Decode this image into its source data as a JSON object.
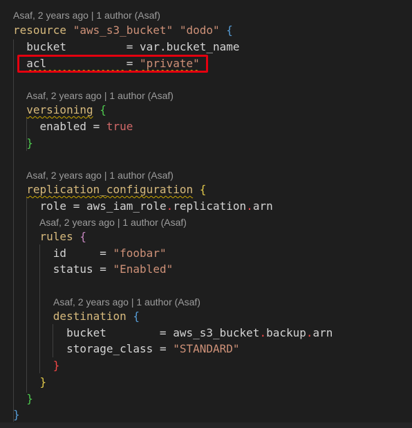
{
  "lens": {
    "resource": "Asaf, 2 years ago | 1 author (Asaf)",
    "versioning": "Asaf, 2 years ago | 1 author (Asaf)",
    "replication": "Asaf, 2 years ago | 1 author (Asaf)",
    "rules": "Asaf, 2 years ago | 1 author (Asaf)",
    "destination": "Asaf, 2 years ago | 1 author (Asaf)"
  },
  "code": {
    "resource_kw": "resource",
    "resource_type": "\"aws_s3_bucket\"",
    "resource_name": "\"dodo\"",
    "open_brace": "{",
    "close_brace": "}",
    "bucket_key": "bucket",
    "bucket_val": "var.bucket_name",
    "acl_key": "acl",
    "acl_val": "\"private\"",
    "versioning_kw": "versioning",
    "enabled_key": "enabled",
    "enabled_val": "true",
    "replication_kw": "replication_configuration",
    "role_key": "role",
    "role_val_a": "aws_iam_role",
    "role_val_b": "replication",
    "role_val_c": "arn",
    "rules_kw": "rules",
    "id_key": "id",
    "id_val": "\"foobar\"",
    "status_key": "status",
    "status_val": "\"Enabled\"",
    "destination_kw": "destination",
    "dest_bucket_key": "bucket",
    "dest_bucket_a": "aws_s3_bucket",
    "dest_bucket_b": "backup",
    "dest_bucket_c": "arn",
    "storage_key": "storage_class",
    "storage_val": "\"STANDARD\"",
    "eq": "=",
    "dot": "."
  },
  "colors": {
    "background": "#1e1e1e",
    "highlight": "#e4000f",
    "keyword": "#d7ba7d",
    "string": "#ce9178"
  }
}
